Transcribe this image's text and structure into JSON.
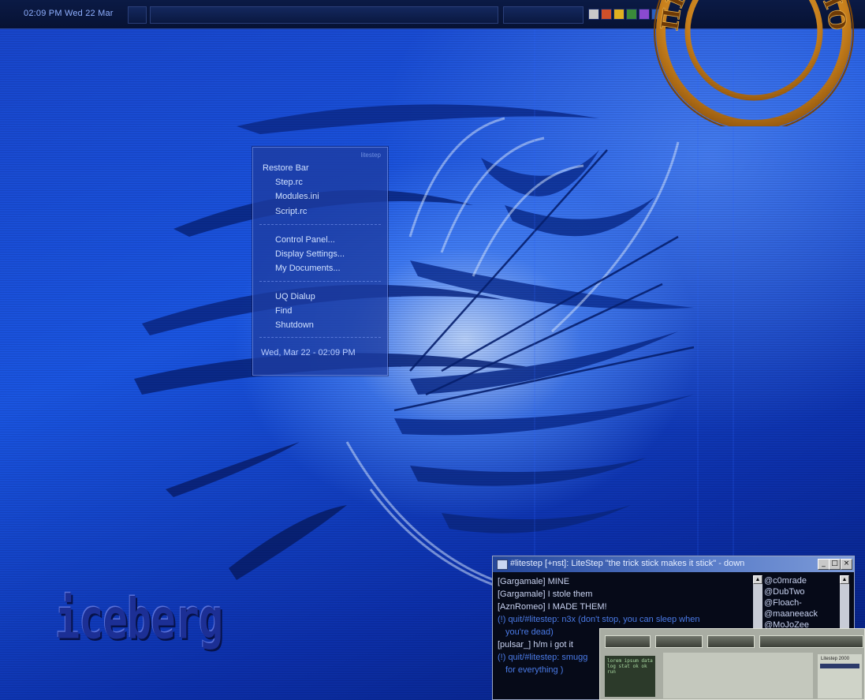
{
  "topbar": {
    "clock": "02:09 PM  Wed 22 Mar"
  },
  "menu": {
    "title": "litestep",
    "items": [
      {
        "label": "Restore Bar"
      },
      {
        "label": "Step.rc"
      },
      {
        "label": "Modules.ini"
      },
      {
        "label": "Script.rc"
      },
      {
        "label": "Control Panel..."
      },
      {
        "label": "Display Settings..."
      },
      {
        "label": "My Documents..."
      },
      {
        "label": "UQ Dialup"
      },
      {
        "label": "Find"
      },
      {
        "label": "Shutdown"
      }
    ],
    "clock": "Wed, Mar 22 - 02:09 PM"
  },
  "irc": {
    "title": "#litestep [+nst]: LiteStep \"the trick stick makes it stick\" - down",
    "buttons": {
      "minimize": "_",
      "maximize": "□",
      "close": "×"
    },
    "lines": [
      {
        "text": "[Gargamale] MINE"
      },
      {
        "text": "[Gargamale] I stole them"
      },
      {
        "text": "[AznRomeo] I MADE THEM!"
      },
      {
        "text": "(!) quit/#litestep: n3x (don't stop, you can sleep when"
      },
      {
        "text": "you're dead)"
      },
      {
        "text": "[pulsar_] h/m i got it"
      },
      {
        "text": "(!) quit/#litestep: smugg"
      },
      {
        "text": "for everything )"
      }
    ],
    "nicks": [
      "@c0mrade",
      "@DubTwo",
      "@Floach-",
      "@maaneeack",
      "@MoJoZee"
    ]
  },
  "app2": {
    "panel_text": "lorem ipsum data log stat ok ok run",
    "side_header": "Litestep 2000"
  },
  "logo": {
    "text": "iceberg"
  },
  "stamp": {
    "text": "ПРОГРАММА·НОМЕРА·"
  },
  "colors": {
    "desktop": "#1a55e0",
    "menu_bg": "#1e3ca0",
    "menu_text": "#cfe0ff",
    "irc_bg": "#060a18",
    "irc_title": "#24469a",
    "stamp": "#c8801c"
  }
}
